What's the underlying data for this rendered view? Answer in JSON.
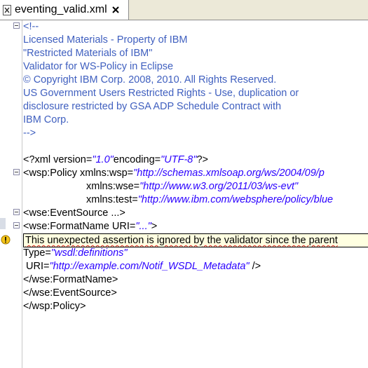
{
  "tab": {
    "file_icon": "xml-file-icon",
    "title": "eventing_valid.xml",
    "close_icon": "close-icon"
  },
  "editor": {
    "comment": {
      "open": "<!--",
      "lines": [
        "Licensed Materials - Property of IBM",
        "\"Restricted Materials of IBM\"",
        "Validator for WS-Policy in Eclipse",
        "© Copyright IBM Corp. 2008, 2010. All Rights Reserved.",
        "US Government Users Restricted Rights - Use, duplication or",
        "disclosure restricted by GSA ADP Schedule Contract with",
        "IBM Corp."
      ],
      "close": "-->"
    },
    "xml_decl": {
      "start": "<?xml version=",
      "version": "\"1.0\"",
      "mid": "encoding=",
      "encoding": "\"UTF-8\"",
      "end": "?>"
    },
    "policy": {
      "open": "<wsp:Policy xmlns:wsp=",
      "wsp_ns": "\"http://schemas.xmlsoap.org/ws/2004/09/p",
      "wse_attr": "xmlns:wse=",
      "wse_ns": "\"http://www.w3.org/2011/03/ws-evt\"",
      "test_attr": "xmlns:test=",
      "test_ns": "\"http://www.ibm.com/websphere/policy/blue"
    },
    "event_source_open": "<wse:EventSource ...>",
    "format_name": {
      "open": "<wse:FormatName URI=",
      "uri": "\"...\"",
      "close": ">"
    },
    "tooltip_text": "This unexpected assertion is ignored by the validator since the parent",
    "type_line": {
      "attr": "Type=",
      "value": "\"wsdl:definitions\""
    },
    "uri_line": {
      "attr": " URI=",
      "value": "\"http://example.com/Notif_WSDL_Metadata\"",
      "end": " />"
    },
    "format_name_close": "</wse:FormatName>",
    "event_source_close": "</wse:EventSource>",
    "policy_close": "</wsp:Policy>",
    "warning_icon": "warning-icon",
    "fold_icon": "collapse-icon"
  },
  "colors": {
    "comment": "#3f5fbf",
    "attribute_value": "#2a00ff",
    "tooltip_bg": "#ffffe1",
    "tab_bar_bg": "#ece9d8"
  }
}
